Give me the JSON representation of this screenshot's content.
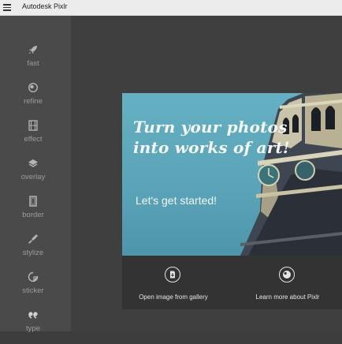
{
  "window": {
    "title": "Autodesk Pixlr"
  },
  "sidebar": {
    "items": [
      {
        "label": "fast",
        "icon": "rocket-icon"
      },
      {
        "label": "refine",
        "icon": "refine-icon"
      },
      {
        "label": "effect",
        "icon": "film-icon"
      },
      {
        "label": "overlay",
        "icon": "layers-icon"
      },
      {
        "label": "border",
        "icon": "border-icon"
      },
      {
        "label": "stylize",
        "icon": "brush-icon"
      },
      {
        "label": "sticker",
        "icon": "sticker-icon"
      },
      {
        "label": "type",
        "icon": "quote-icon"
      }
    ]
  },
  "hero": {
    "heading_line1": "Turn your photos",
    "heading_line2": "into works of art!",
    "subheading": "Let's get started!"
  },
  "actions": {
    "open_gallery": "Open image from gallery",
    "learn_more": "Learn more about Pixlr"
  },
  "colors": {
    "sidebar_bg": "#4a4a4a",
    "main_bg": "#3f3f3f",
    "hero_sky": "#5aa3b8",
    "action_bar": "#333333"
  }
}
